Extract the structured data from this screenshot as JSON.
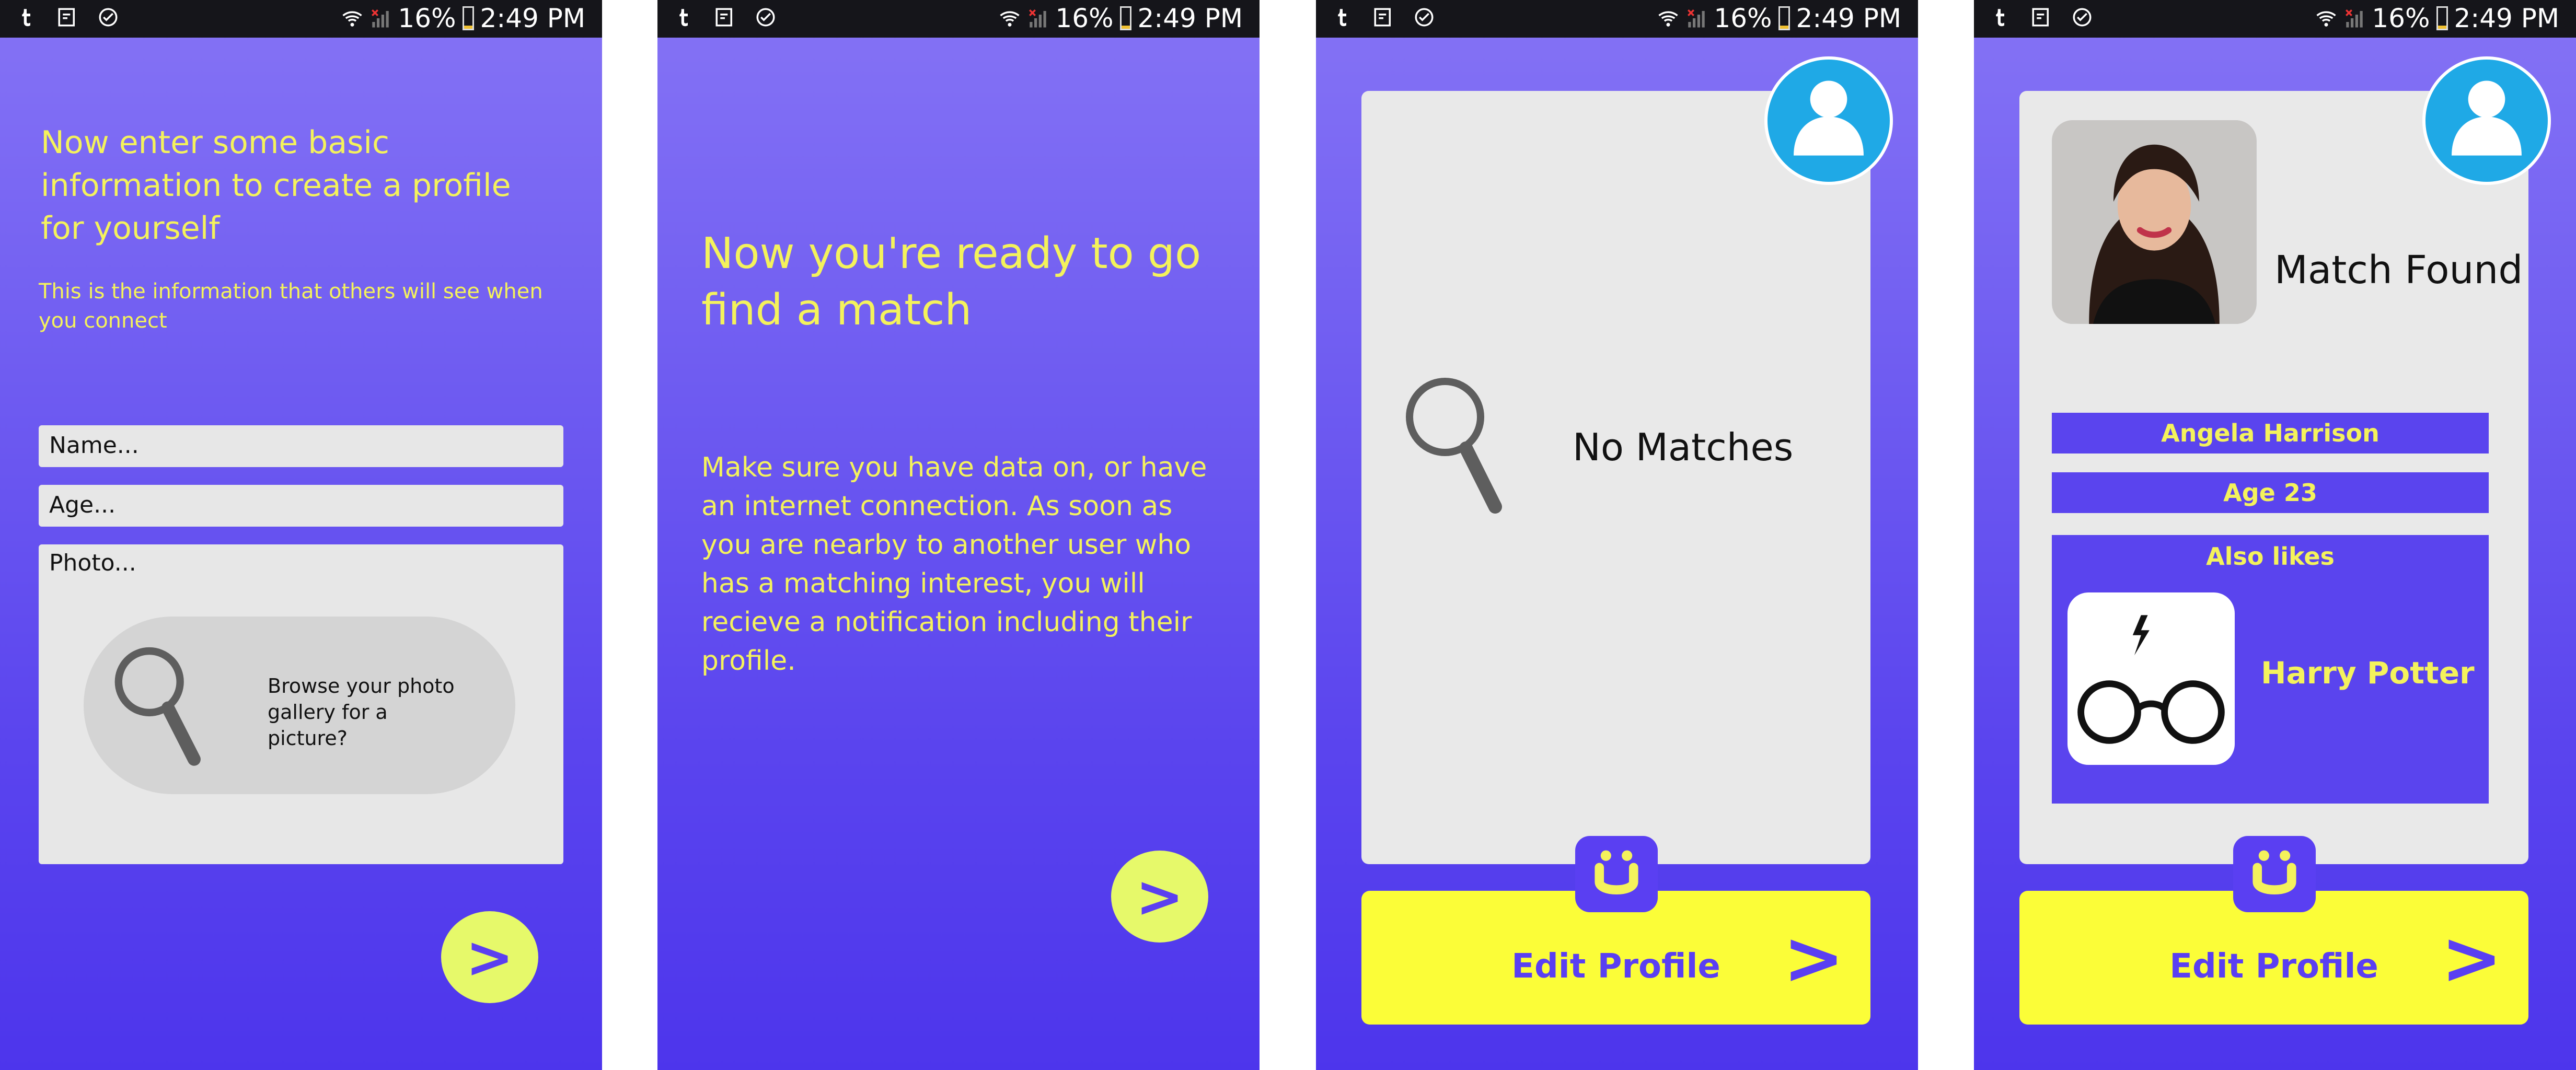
{
  "status_bar": {
    "battery": "16%",
    "time": "2:49 PM"
  },
  "screen1": {
    "heading": "Now enter some basic information to create a profile for yourself",
    "subtext": "This is the information that others will see when you connect",
    "name_placeholder": "Name...",
    "age_placeholder": "Age...",
    "photo_label": "Photo...",
    "browse_text": "Browse your photo gallery for a picture?",
    "next_label": ">"
  },
  "screen2": {
    "heading": "Now you're ready to go find a match",
    "body": "Make sure you have data on, or have an internet connection. As soon as you are nearby to another user who has a matching interest, you will recieve a notification including their profile.",
    "next_label": ">"
  },
  "screen3": {
    "status_text": "No Matches",
    "edit_profile": "Edit Profile",
    "edit_arrow": ">"
  },
  "screen4": {
    "match_title": "Match Found",
    "name": "Angela Harrison",
    "age": "Age 23",
    "also_likes_label": "Also likes",
    "interest": "Harry Potter",
    "edit_profile": "Edit Profile",
    "edit_arrow": ">"
  },
  "colors": {
    "accent_yellow": "#f4f25c",
    "purple": "#5a44ee",
    "button_lime": "#e6f96a",
    "edit_bar_yellow": "#fbfd38",
    "avatar_blue": "#1fa9e6"
  }
}
